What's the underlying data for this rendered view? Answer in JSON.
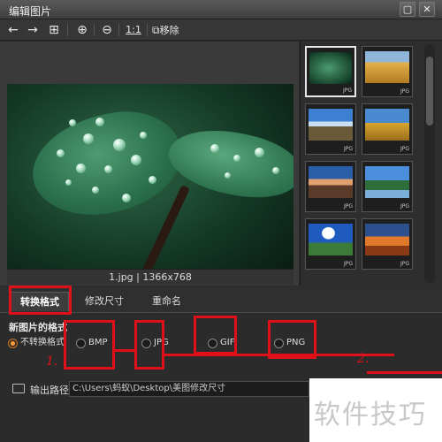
{
  "window": {
    "title": "编辑图片",
    "btn_maximize": "▢",
    "btn_close": "✕"
  },
  "toolbar": {
    "remove_label": "移除",
    "actual_size": "1:1"
  },
  "viewer": {
    "caption": "1.jpg | 1366x768"
  },
  "thumbnails": [
    {
      "tag": "JPG",
      "selected": true
    },
    {
      "tag": "JPG",
      "selected": false
    },
    {
      "tag": "JPG",
      "selected": false
    },
    {
      "tag": "JPG",
      "selected": false
    },
    {
      "tag": "JPG",
      "selected": false
    },
    {
      "tag": "JPG",
      "selected": false
    },
    {
      "tag": "JPG",
      "selected": false
    },
    {
      "tag": "JPG",
      "selected": false
    }
  ],
  "tabs": [
    {
      "label": "转换格式",
      "active": true
    },
    {
      "label": "修改尺寸",
      "active": false
    },
    {
      "label": "重命名",
      "active": false
    }
  ],
  "format": {
    "section_label": "新图片的格式",
    "options": [
      "不转换格式",
      "BMP",
      "JPG",
      "GIF",
      "PNG"
    ],
    "selected": "不转换格式"
  },
  "output": {
    "label": "输出路径",
    "path": "C:\\Users\\蚂蚁\\Desktop\\美图修改尺寸"
  },
  "annotations": {
    "num1": "1.",
    "num2": "2."
  },
  "watermark": "软件技巧",
  "colors": {
    "annotation": "#e0101a",
    "background": "#2b2b2b"
  }
}
